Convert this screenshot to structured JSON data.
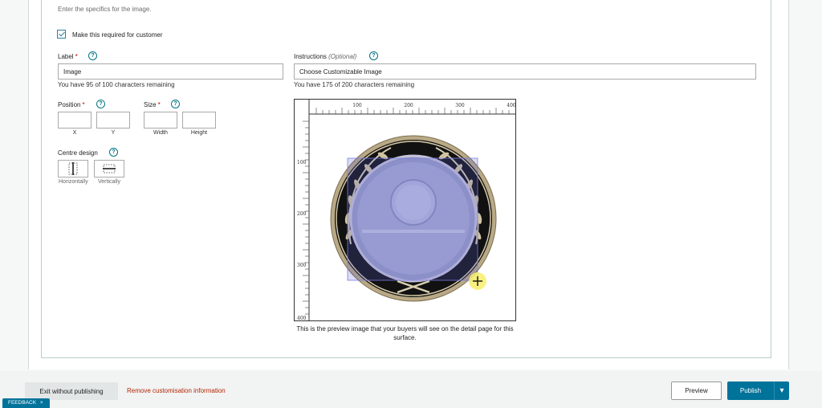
{
  "form": {
    "subtitle": "Enter the specifics for the image.",
    "required_label": "Make this required for customer",
    "label_field": {
      "label": "Label",
      "required_mark": "*",
      "value": "Image",
      "hint": "You have 95 of 100 characters remaining"
    },
    "instructions_field": {
      "label": "Instructions",
      "optional": "(Optional)",
      "value": "Choose Customizable Image",
      "hint": "You have 175 of 200 characters remaining"
    },
    "position": {
      "label": "Position",
      "required_mark": "*",
      "x_label": "X",
      "y_label": "Y"
    },
    "size": {
      "label": "Size",
      "required_mark": "*",
      "width_label": "Width",
      "height_label": "Height"
    },
    "centre": {
      "label": "Centre design",
      "horizontal": "Horizontally",
      "vertical": "Vertically"
    },
    "help_icon": "?"
  },
  "preview": {
    "ruler_x_labels": [
      "100",
      "200",
      "300",
      "400"
    ],
    "ruler_y_labels": [
      "100",
      "200",
      "300",
      "400"
    ],
    "caption": "This is the preview image that your buyers will see on the detail page for this surface.",
    "image_name": "medallion-coin",
    "colors": {
      "selection": "#5a5fd6",
      "cursor_highlight": "#f7ee6b"
    }
  },
  "footer": {
    "exit_label": "Exit without publishing",
    "remove_label": "Remove customisation information",
    "preview_label": "Preview",
    "publish_label": "Publish",
    "publish_caret": "▾"
  },
  "feedback": {
    "label": "FEEDBACK",
    "close": "×"
  },
  "theme": {
    "primary": "#00739b",
    "danger_link": "#b12704"
  }
}
